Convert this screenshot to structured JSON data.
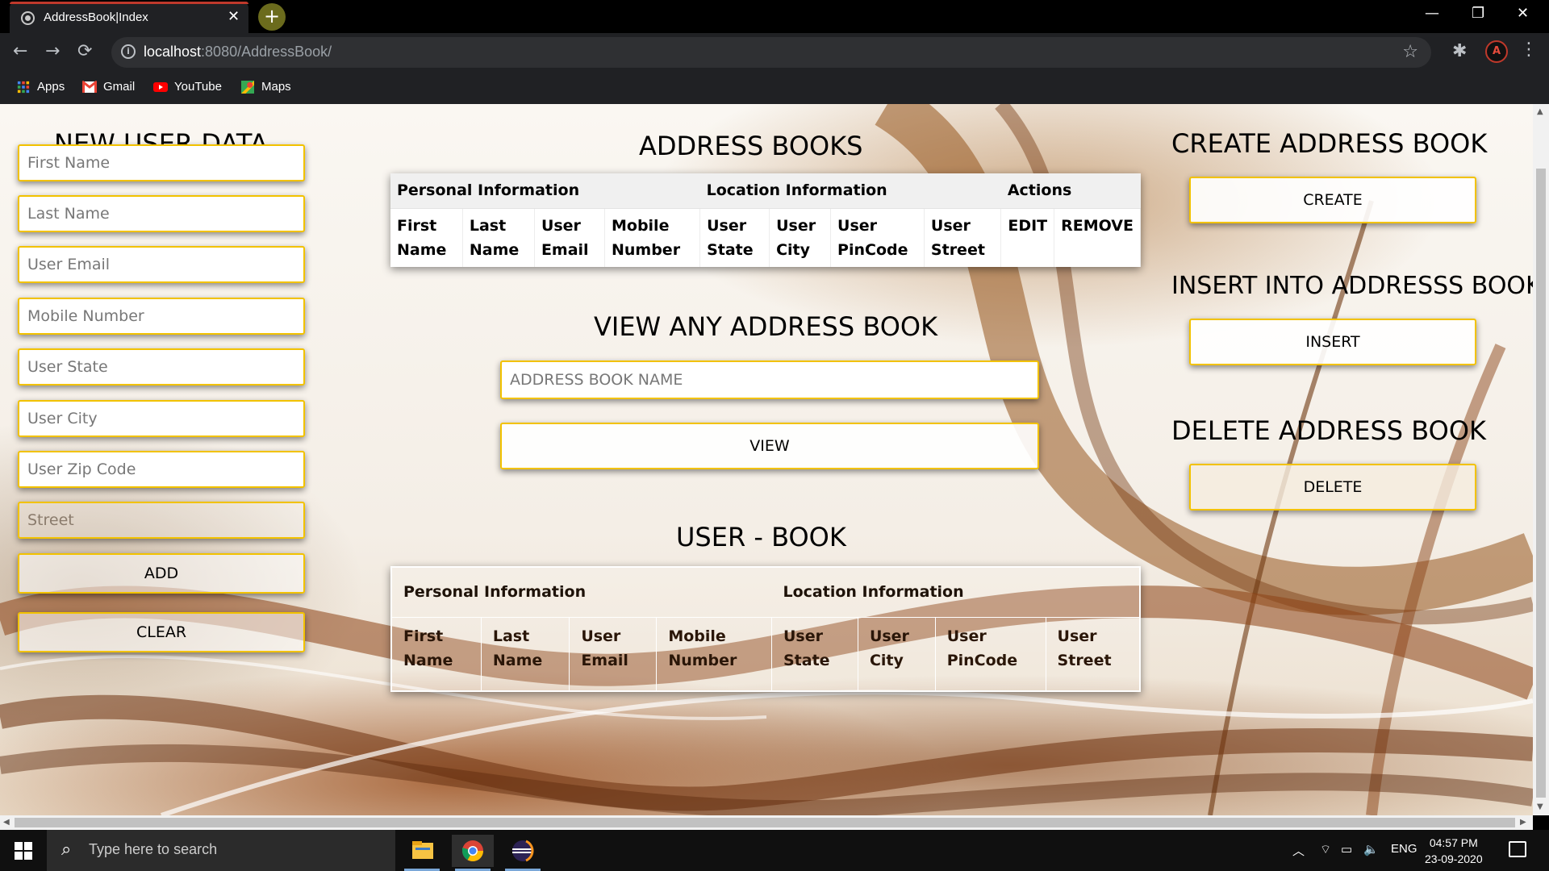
{
  "browser": {
    "tab_title": "AddressBook|Index",
    "url_host": "localhost",
    "url_path": ":8080/AddressBook/",
    "bookmarks": [
      {
        "label": "Apps",
        "icon": "apps-grid-icon"
      },
      {
        "label": "Gmail",
        "icon": "gmail-icon"
      },
      {
        "label": "YouTube",
        "icon": "youtube-icon"
      },
      {
        "label": "Maps",
        "icon": "maps-icon"
      }
    ]
  },
  "new_user": {
    "title": "NEW USER DATA",
    "fields": [
      {
        "placeholder": "First Name"
      },
      {
        "placeholder": "Last Name"
      },
      {
        "placeholder": "User Email"
      },
      {
        "placeholder": "Mobile Number"
      },
      {
        "placeholder": "User State"
      },
      {
        "placeholder": "User City"
      },
      {
        "placeholder": "User Zip Code"
      },
      {
        "placeholder": "Street"
      }
    ],
    "add_label": "ADD",
    "clear_label": "CLEAR"
  },
  "address_books": {
    "title": "ADDRESS BOOKS",
    "groups": [
      "Personal Information",
      "Location Information",
      "Actions"
    ],
    "columns": [
      "First Name",
      "Last Name",
      "User Email",
      "Mobile Number",
      "User State",
      "User City",
      "User PinCode",
      "User Street",
      "EDIT",
      "REMOVE"
    ]
  },
  "view_book": {
    "title": "VIEW ANY ADDRESS BOOK",
    "input_placeholder": "ADDRESS BOOK NAME",
    "view_label": "VIEW"
  },
  "user_book": {
    "title": "USER - BOOK",
    "groups": [
      "Personal Information",
      "Location Information"
    ],
    "columns": [
      "First Name",
      "Last Name",
      "User Email",
      "Mobile Number",
      "User State",
      "User City",
      "User PinCode",
      "User Street"
    ]
  },
  "right_panel": {
    "create_title": "CREATE ADDRESS BOOK",
    "create_label": "CREATE",
    "insert_title": "INSERT INTO ADDRESSS BOOK",
    "insert_label": "INSERT",
    "delete_title": "DELETE ADDRESS BOOK",
    "delete_label": "DELETE"
  },
  "taskbar": {
    "search_placeholder": "Type here to search",
    "language": "ENG",
    "time": "04:57 PM",
    "date": "23-09-2020"
  }
}
